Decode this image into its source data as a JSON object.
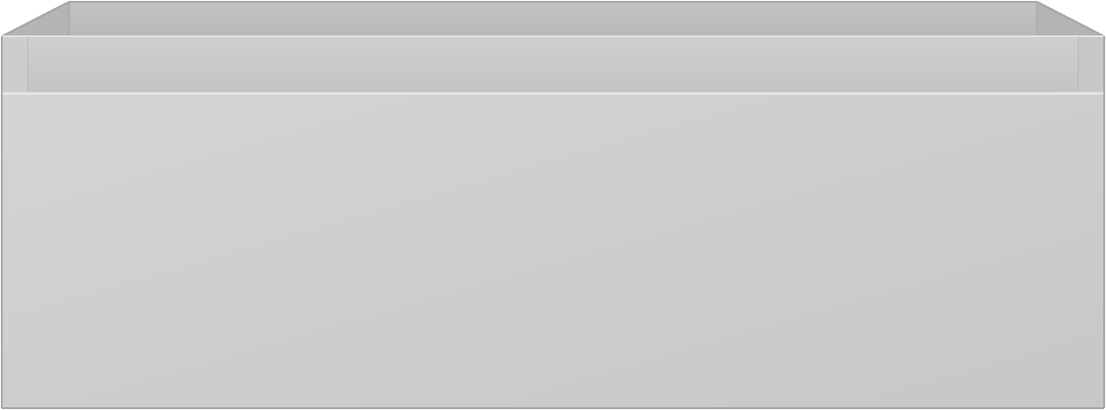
{
  "product": {
    "name": "drawer-unit",
    "colors": {
      "front_panel": "#cbcbc9",
      "front_panel_light": "#d2d2d0",
      "rim": "#c6c6c4",
      "inner_back": "#bcbcba",
      "inner_side": "#b2b2b0",
      "edge_highlight": "#e6e6e4",
      "edge_shadow": "#a9a9a7",
      "outline": "#9c9c9a"
    }
  }
}
